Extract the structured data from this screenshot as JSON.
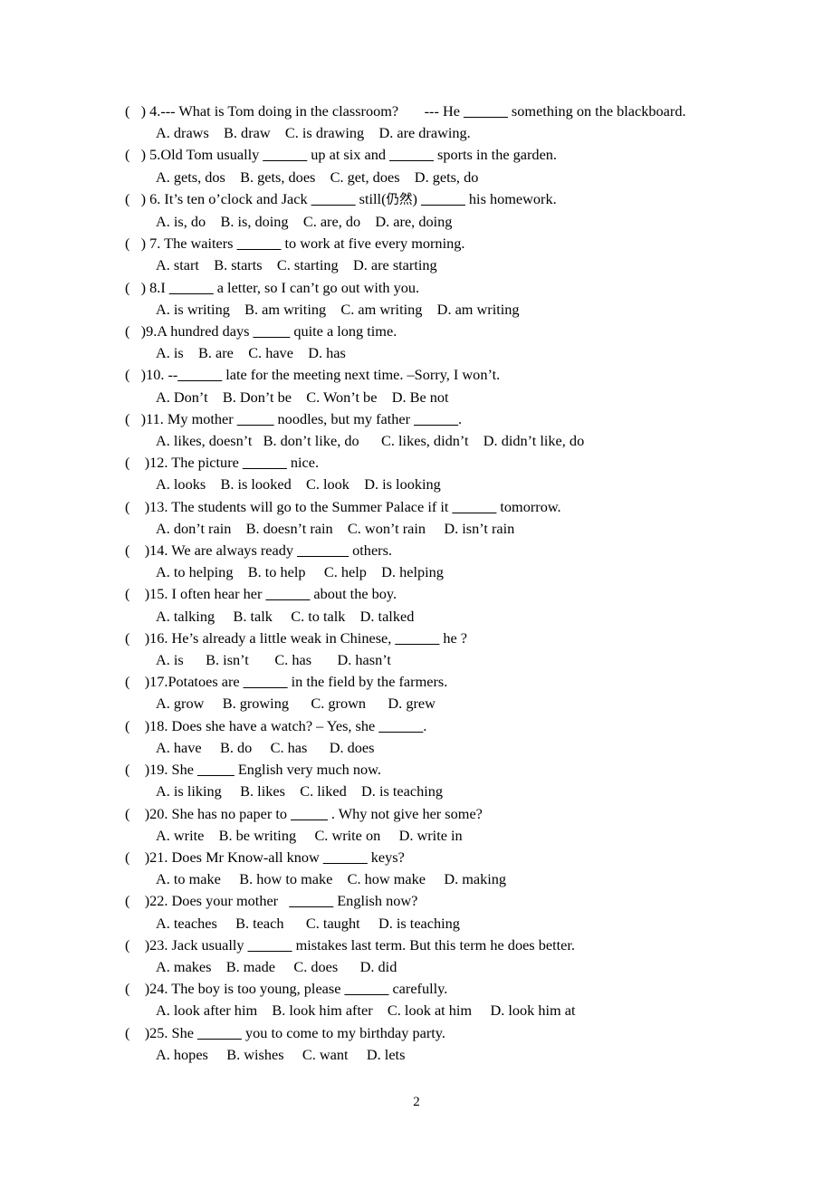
{
  "document": {
    "page_number": "2",
    "questions": [
      {
        "marker": "(   ) ",
        "number": "4.",
        "stem_before": "--- What is Tom doing in the classroom?       --- He ",
        "blank": "______",
        "stem_after": " something on the blackboard.",
        "options": "A. draws    B. draw    C. is drawing    D. are drawing."
      },
      {
        "marker": "(   ) ",
        "number": "5.",
        "stem_before": "Old Tom usually ",
        "blank": "______",
        "stem_after": " up at six and ______ sports in the garden.",
        "options": "A. gets, dos    B. gets, does    C. get, does    D. gets, do"
      },
      {
        "marker": "(   ) ",
        "number": "6. ",
        "stem_before": "It’s ten o’clock and Jack ",
        "blank": "______",
        "stem_after": " still(仍然) ______ his homework.",
        "options": "A. is, do    B. is, doing    C. are, do    D. are, doing"
      },
      {
        "marker": "(   ) ",
        "number": "7. ",
        "stem_before": "The waiters ",
        "blank": "______",
        "stem_after": " to work at five every morning.",
        "options": "A. start    B. starts    C. starting    D. are starting"
      },
      {
        "marker": "(   ) ",
        "number": "8.",
        "stem_before": "I ",
        "blank": "______",
        "stem_after": " a letter, so I can’t go out with you.",
        "options": "A. is writing    B. am writing    C. am writing    D. am writing"
      },
      {
        "marker": "(   )",
        "number": "9.",
        "stem_before": "A hundred days ",
        "blank": "_____",
        "stem_after": " quite a long time.",
        "options": "A. is    B. are    C. have    D. has"
      },
      {
        "marker": "(   )",
        "number": "10. ",
        "stem_before": "--",
        "blank": "______",
        "stem_after": " late for the meeting next time. –Sorry, I won’t.",
        "options": "A. Don’t    B. Don’t be    C. Won’t be    D. Be not"
      },
      {
        "marker": "(   )",
        "number": "11. ",
        "stem_before": "My mother ",
        "blank": "_____",
        "stem_after": " noodles, but my father ______.",
        "options": "A. likes, doesn’t   B. don’t like, do      C. likes, didn’t    D. didn’t like, do"
      },
      {
        "marker": "(    )",
        "number": "12. ",
        "stem_before": "The picture ",
        "blank": "______",
        "stem_after": " nice.",
        "options": "A. looks    B. is looked    C. look    D. is looking"
      },
      {
        "marker": "(    )",
        "number": "13. ",
        "stem_before": "The students will go to the Summer Palace if it ",
        "blank": "______",
        "stem_after": " tomorrow.",
        "options": "A. don’t rain    B. doesn’t rain    C. won’t rain     D. isn’t rain"
      },
      {
        "marker": "(    )",
        "number": "14. ",
        "stem_before": "We are always ready ",
        "blank": "_______",
        "stem_after": " others.",
        "options": "A. to helping    B. to help     C. help    D. helping"
      },
      {
        "marker": "(    )",
        "number": "15. ",
        "stem_before": "I often hear her ",
        "blank": "______",
        "stem_after": " about the boy.",
        "options": "A. talking     B. talk     C. to talk    D. talked"
      },
      {
        "marker": "(    )",
        "number": "16. ",
        "stem_before": "He’s already a little weak in Chinese, ",
        "blank": "______",
        "stem_after": " he ?",
        "options": "A. is      B. isn’t       C. has       D. hasn’t"
      },
      {
        "marker": "(    )",
        "number": "17.",
        "stem_before": "Potatoes are ",
        "blank": "______",
        "stem_after": " in the field by the farmers.",
        "options": "A. grow     B. growing      C. grown      D. grew"
      },
      {
        "marker": "(    )",
        "number": "18. ",
        "stem_before": "Does she have a watch? – Yes, she ",
        "blank": "______",
        "stem_after": ".",
        "options": "A. have     B. do     C. has      D. does"
      },
      {
        "marker": "(    )",
        "number": "19. ",
        "stem_before": "She ",
        "blank": "_____",
        "stem_after": " English very much now.",
        "options": "A. is liking     B. likes    C. liked    D. is teaching"
      },
      {
        "marker": "(    )",
        "number": "20. ",
        "stem_before": "She has no paper to ",
        "blank": "_____",
        "stem_after": " . Why not give her some?",
        "options": "A. write    B. be writing     C. write on     D. write in"
      },
      {
        "marker": "(    )",
        "number": "21. ",
        "stem_before": "Does Mr Know-all know ",
        "blank": "______",
        "stem_after": " keys?",
        "options": "A. to make     B. how to make    C. how make     D. making"
      },
      {
        "marker": "(    )",
        "number": "22. ",
        "stem_before": "Does your mother   ",
        "blank": "______",
        "stem_after": " English now?",
        "options": "A. teaches     B. teach      C. taught     D. is teaching"
      },
      {
        "marker": "(    )",
        "number": "23. ",
        "stem_before": "Jack usually ",
        "blank": "______",
        "stem_after": " mistakes last term. But this term he does better.",
        "options": "A. makes    B. made     C. does      D. did"
      },
      {
        "marker": "(    )",
        "number": "24. ",
        "stem_before": "The boy is too young, please ",
        "blank": "______",
        "stem_after": " carefully.",
        "options": "A. look after him    B. look him after    C. look at him     D. look him at"
      },
      {
        "marker": "(    )",
        "number": "25. ",
        "stem_before": "She ",
        "blank": "______",
        "stem_after": " you to come to my birthday party.",
        "options": "A. hopes     B. wishes     C. want     D. lets"
      }
    ]
  }
}
